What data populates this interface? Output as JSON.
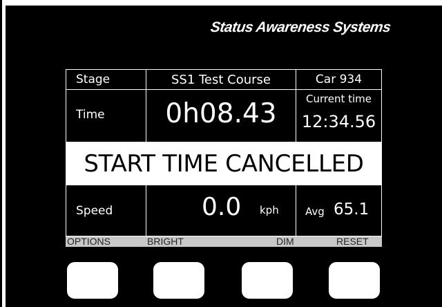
{
  "brand": "Status Awareness Systems",
  "stage": {
    "label": "Stage",
    "value": "SS1 Test Course",
    "car": "Car 934"
  },
  "time": {
    "label": "Time",
    "value": "0h08.43",
    "current_label": "Current time",
    "current_value": "12:34.56"
  },
  "message": "START TIME CANCELLED",
  "speed": {
    "label": "Speed",
    "value": "0.0",
    "unit": "kph",
    "avg_label": "Avg",
    "avg_value": "65.1"
  },
  "softkeys": {
    "options": "OPTIONS",
    "bright": "BRIGHT",
    "dim": "DIM",
    "reset": "RESET"
  },
  "colors": {
    "background": "#000000",
    "text": "#ffffff",
    "banner": "#ffffff",
    "softbar": "#c8c8c8"
  }
}
